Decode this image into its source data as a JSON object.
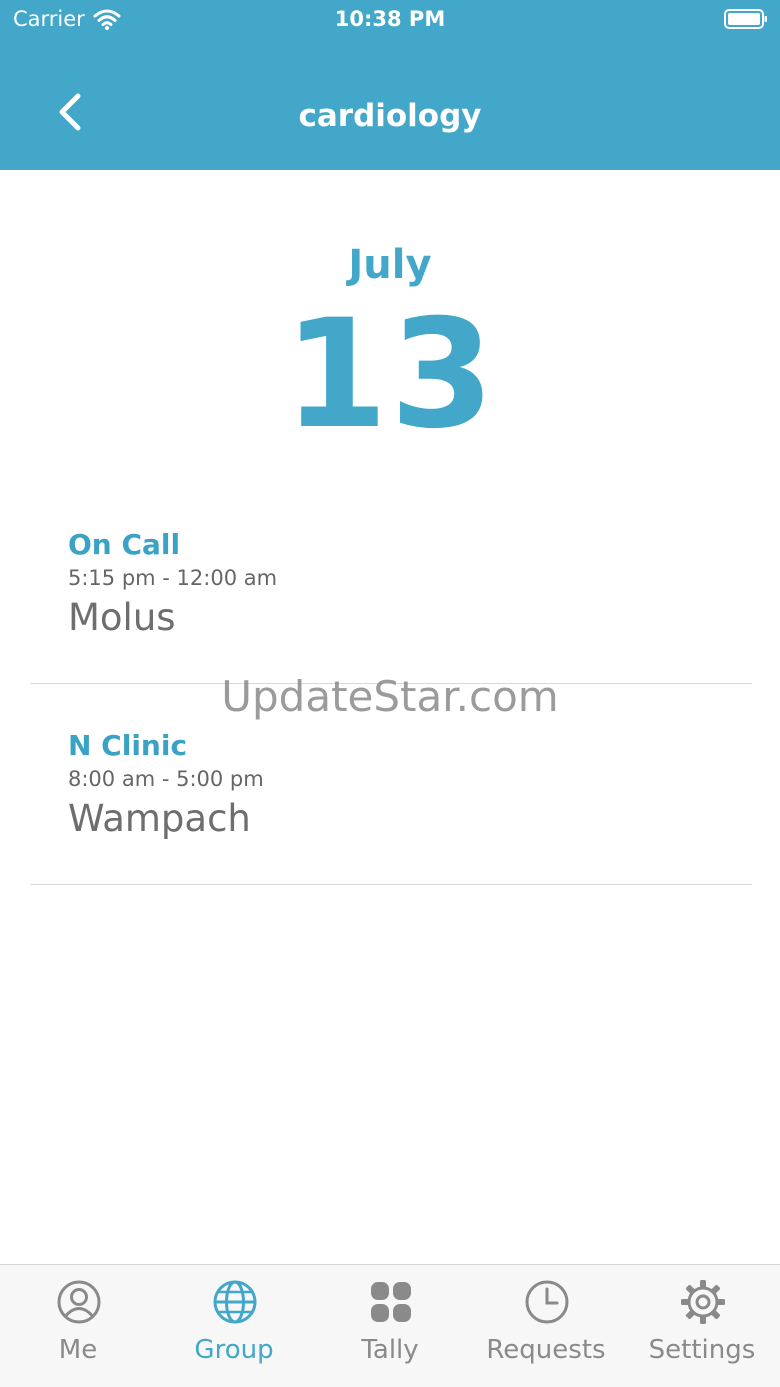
{
  "status_bar": {
    "carrier": "Carrier",
    "time": "10:38 PM"
  },
  "nav": {
    "title": "cardiology"
  },
  "date": {
    "month": "July",
    "day": "13"
  },
  "shifts": [
    {
      "type": "On Call",
      "hours": "5:15 pm - 12:00 am",
      "person": "Molus"
    },
    {
      "type": "N Clinic",
      "hours": "8:00 am - 5:00 pm",
      "person": "Wampach"
    }
  ],
  "watermark": "UpdateStar.com",
  "tabs": [
    {
      "label": "Me",
      "icon": "person-icon",
      "active": false
    },
    {
      "label": "Group",
      "icon": "globe-icon",
      "active": true
    },
    {
      "label": "Tally",
      "icon": "grid-icon",
      "active": false
    },
    {
      "label": "Requests",
      "icon": "clock-icon",
      "active": false
    },
    {
      "label": "Settings",
      "icon": "gear-icon",
      "active": false
    }
  ],
  "colors": {
    "accent": "#42a7c8",
    "inactive": "#8a8a8a",
    "tabbar_bg": "#f7f7f7"
  }
}
